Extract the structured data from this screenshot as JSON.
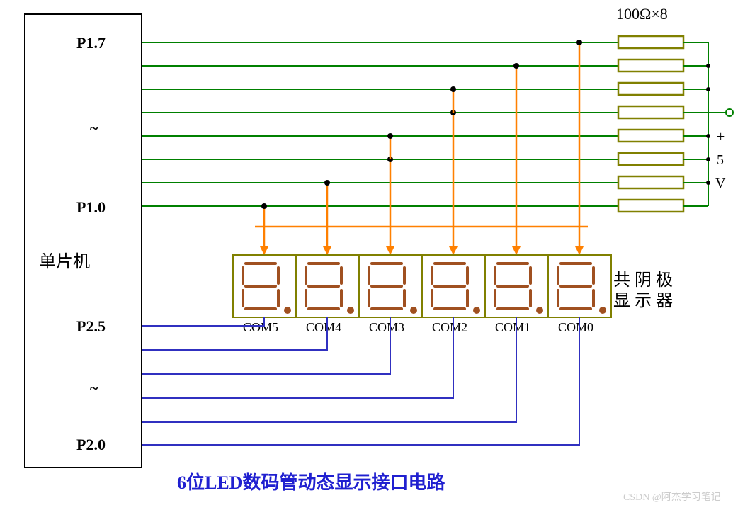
{
  "mcu": {
    "title": "单片机",
    "p17": "P1.7",
    "p10": "P1.0",
    "p25": "P2.5",
    "p20": "P2.0",
    "tilde1": "~",
    "tilde2": "~"
  },
  "resistor_label": "100Ω×8",
  "psu": {
    "plus": "+",
    "five": "5",
    "v": "V"
  },
  "display_label_1": "共 阴 极",
  "display_label_2": "显 示 器",
  "com": [
    "COM5",
    "COM4",
    "COM3",
    "COM2",
    "COM1",
    "COM0"
  ],
  "title": "6位LED数码管动态显示接口电路",
  "watermark": "CSDN @阿杰学习笔记"
}
